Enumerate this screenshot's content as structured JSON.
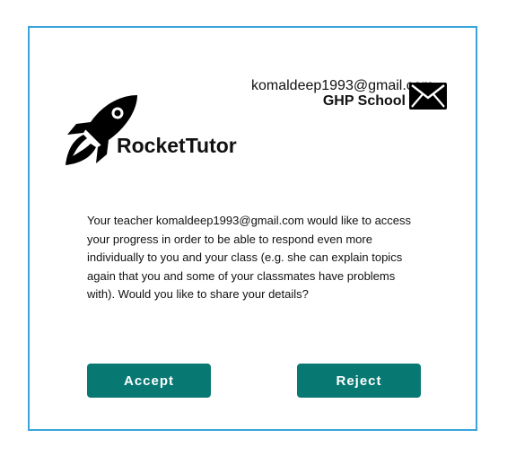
{
  "header": {
    "email": "komaldeep1993@gmail.com",
    "school": "GHP School",
    "mail_icon": "envelope-icon"
  },
  "brand": {
    "name": "RocketTutor",
    "icon": "rocket-icon"
  },
  "message": "Your teacher komaldeep1993@gmail.com would like to access your progress in order to be able to respond even more individually to you and your class (e.g. she can explain topics again that you and some of your classmates have problems with). Would you like to share your details?",
  "actions": {
    "accept_label": "Accept",
    "reject_label": "Reject"
  },
  "colors": {
    "border": "#3aa4dc",
    "button": "#087873"
  }
}
